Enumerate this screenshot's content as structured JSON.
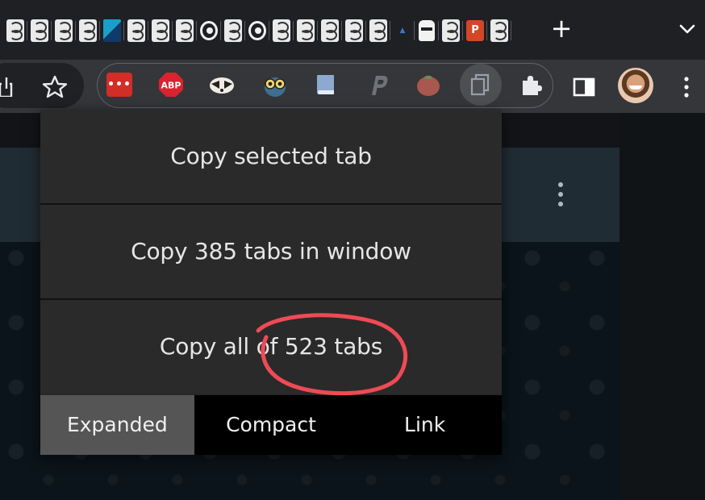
{
  "tabstrip": {
    "tabs": [
      {
        "icon": "c-logo-icon"
      },
      {
        "icon": "c-logo-icon"
      },
      {
        "icon": "c-logo-icon"
      },
      {
        "icon": "c-logo-icon"
      },
      {
        "icon": "k-logo-icon"
      },
      {
        "icon": "c-logo-icon"
      },
      {
        "icon": "c-logo-icon"
      },
      {
        "icon": "c-logo-icon"
      },
      {
        "icon": "google-logo-icon"
      },
      {
        "icon": "c-logo-icon"
      },
      {
        "icon": "google-logo-icon"
      },
      {
        "icon": "c-logo-icon"
      },
      {
        "icon": "c-logo-icon"
      },
      {
        "icon": "c-logo-icon"
      },
      {
        "icon": "c-logo-icon"
      },
      {
        "icon": "c-logo-icon"
      },
      {
        "icon": "a-logo-icon"
      },
      {
        "icon": "helmet-icon"
      },
      {
        "icon": "c-logo-icon"
      },
      {
        "icon": "powerpoint-icon"
      },
      {
        "icon": "c-logo-icon"
      }
    ],
    "new_tab_label": "+",
    "tab_search_icon": "chevron-down-icon"
  },
  "toolbar": {
    "extensions": [
      {
        "name": "lastpass-icon",
        "label": "•••"
      },
      {
        "name": "adblock-plus-icon",
        "label": "ABP"
      },
      {
        "name": "badger-icon"
      },
      {
        "name": "owl-icon"
      },
      {
        "name": "book-icon"
      },
      {
        "name": "p-logo-icon"
      },
      {
        "name": "tomato-icon"
      },
      {
        "name": "copy-tabs-icon",
        "active": true
      },
      {
        "name": "puzzle-icon"
      }
    ]
  },
  "popup": {
    "copy_selected": "Copy selected tab",
    "copy_window": "Copy 385 tabs in window",
    "copy_all": "Copy all of 523 tabs",
    "modes": [
      "Expanded",
      "Compact",
      "Link"
    ],
    "active_mode": "Expanded"
  },
  "colors": {
    "annotation": "#ef4a55",
    "active_mode_bg": "#555555",
    "lastpass_red": "#d32d27",
    "abp_red": "#d9232e"
  }
}
